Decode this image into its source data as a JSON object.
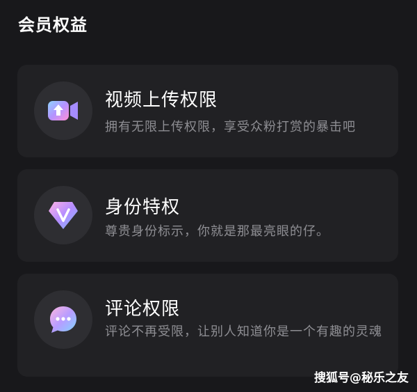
{
  "header": {
    "title": "会员权益"
  },
  "benefits": [
    {
      "title": "视频上传权限",
      "description": "拥有无限上传权限，享受众粉打赏的暴击吧",
      "icon": "video-upload-icon"
    },
    {
      "title": "身份特权",
      "description": "尊贵身份标示，你就是那最亮眼的仔。",
      "icon": "v-badge-icon"
    },
    {
      "title": "评论权限",
      "description": "评论不再受限，让别人知道你是一个有趣的灵魂",
      "icon": "chat-bubble-icon"
    }
  ],
  "watermark": "搜狐号@秘乐之友"
}
